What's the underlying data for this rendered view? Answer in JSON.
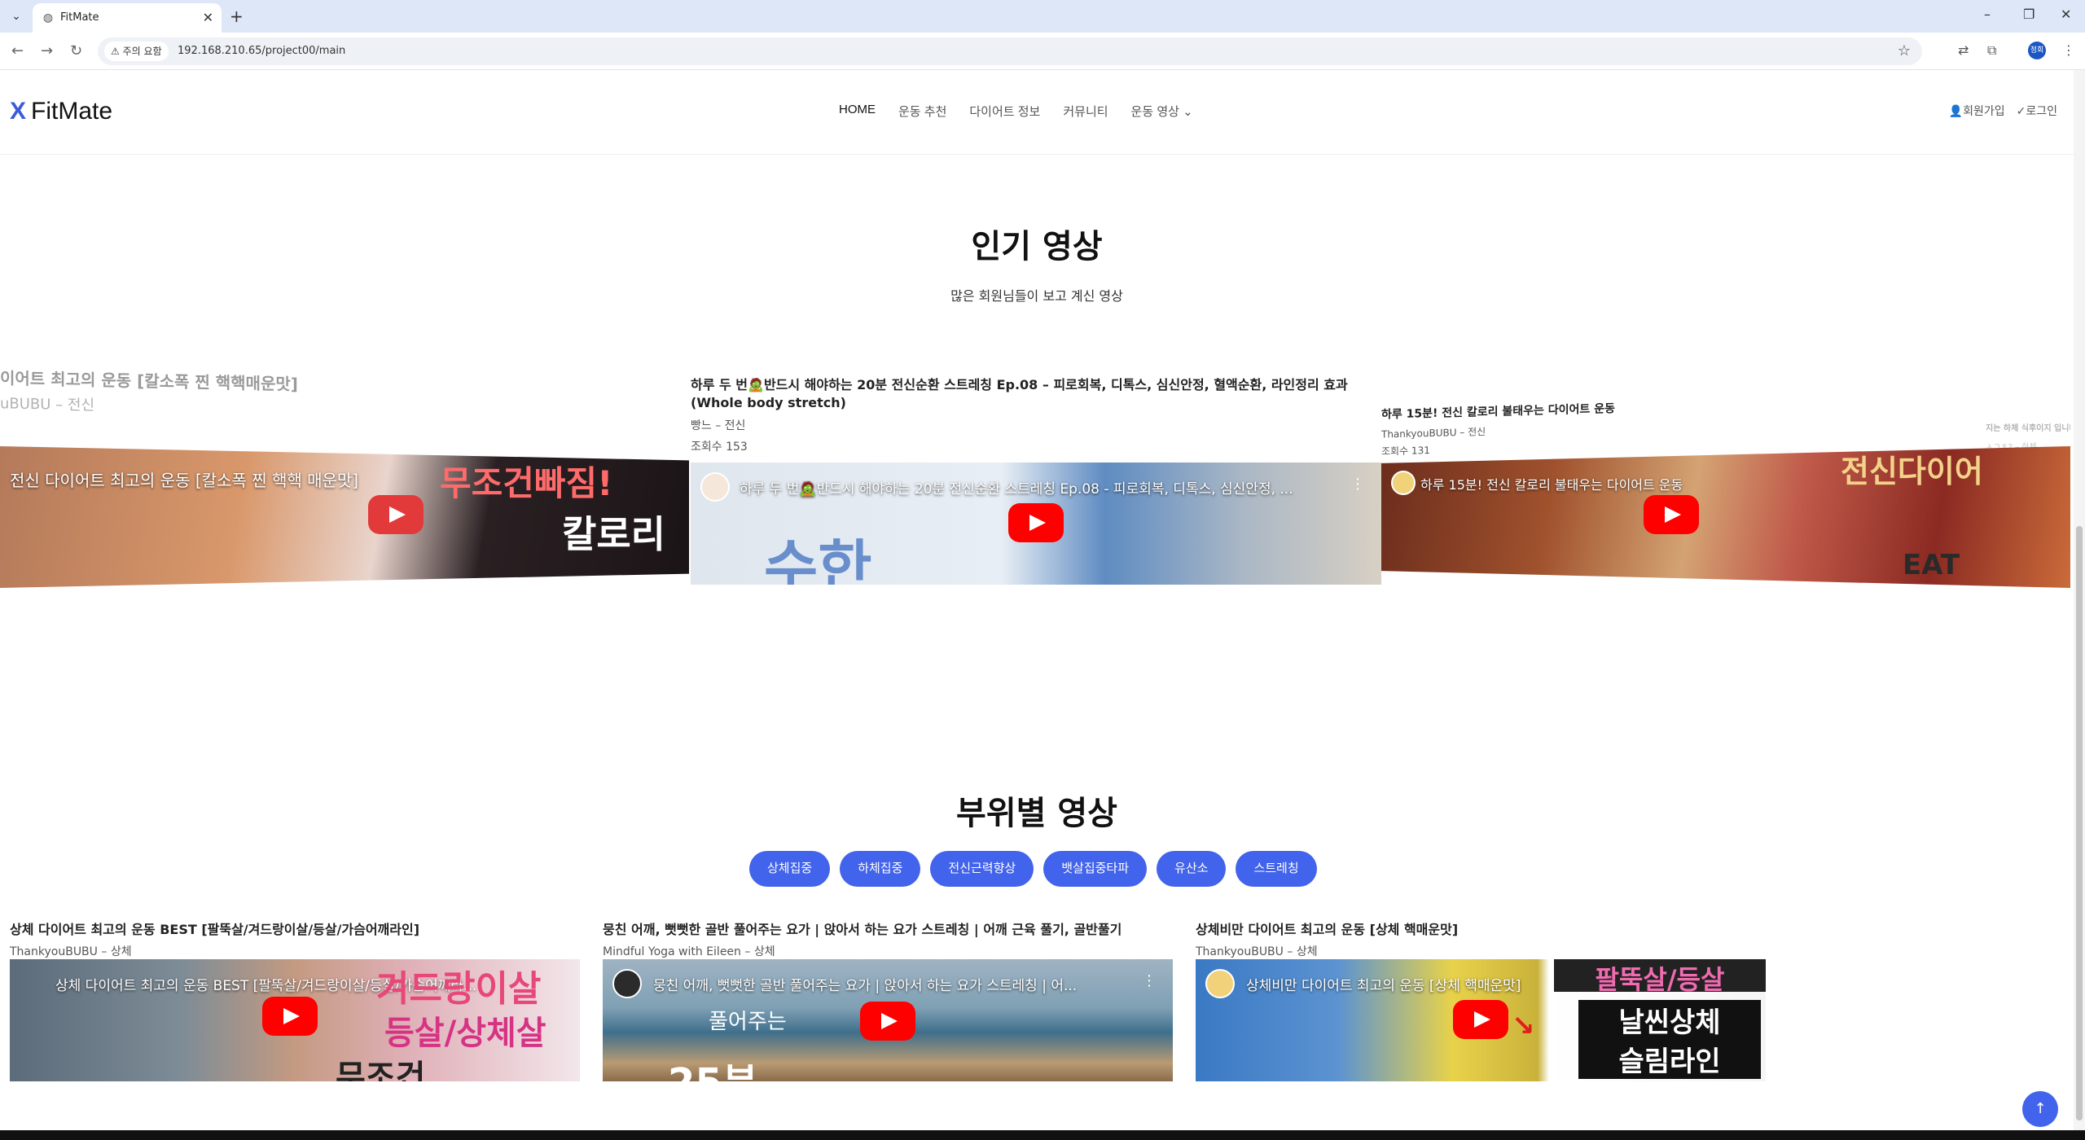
{
  "browser": {
    "tab_title": "FitMate",
    "security_label": "주의 요함",
    "url": "192.168.210.65/project00/main",
    "profile_initial": "정회"
  },
  "header": {
    "logo_mark": "X",
    "logo_text": "FitMate",
    "nav": [
      "HOME",
      "운동 추천",
      "다이어트 정보",
      "커뮤니티",
      "운동 영상"
    ],
    "signup": "회원가입",
    "login": "로그인"
  },
  "popular": {
    "title": "인기 영상",
    "subtitle": "많은 회원님들이 보고 계신 영상",
    "left_card": {
      "title": "이어트 최고의 운동 [칼소폭 찐 핵핵매운맛]",
      "meta": "uBUBU – 전신",
      "thumb_caption": "전신 다이어트 최고의 운동 [칼소폭 찐 핵핵 매운맛]",
      "overlay_1": "무조건빠짐!",
      "overlay_2": "칼로리"
    },
    "center_card": {
      "title": "하루 두 번🧟반드시 해야하는 20분 전신순환 스트레칭 Ep.08 – 피로회복, 디톡스, 심신안정, 혈액순환, 라인정리 효과 (Whole body stretch)",
      "meta": "빵느 – 전신",
      "views": "조회수 153",
      "thumb_caption": "하루 두 번🧟반드시 해야하는 20분 전신순환 스트레칭 Ep.08 - 피로회복, 디톡스, 심신안정, ..."
    },
    "right_card": {
      "title": "하루 15분! 전신 칼로리 불태우는 다이어트 운동",
      "meta": "ThankyouBUBU – 전신",
      "views": "조회수 131",
      "thumb_caption": "하루 15분! 전신 칼로리 불태우는 다이어트 운동",
      "overlay_1": "전신다이어",
      "overlay_2": "EAT"
    },
    "far_right_card": {
      "title": "지는 하체 식후이지 입니다",
      "meta": "ㅅㄱㅊ? – 하체"
    }
  },
  "body_parts": {
    "title": "부위별 영상",
    "filters": [
      "상체집중",
      "하체집중",
      "전신근력향상",
      "뱃살집중타파",
      "유산소",
      "스트레칭"
    ],
    "cards": [
      {
        "title": "상체 다이어트 최고의 운동 BEST [팔뚝살/겨드랑이살/등살/가슴어깨라인]",
        "meta": "ThankyouBUBU – 상체",
        "thumb_caption": "상체 다이어트 최고의 운동 BEST [팔뚝살/겨드랑이살/등살/가슴어깨라...",
        "overlay_1": "겨드랑이살",
        "overlay_2": "등살/상체살",
        "overlay_3": "무조건"
      },
      {
        "title": "뭉친 어깨, 뻣뻣한 골반 풀어주는 요가 | 앉아서 하는 요가 스트레칭 | 어깨 근육 풀기, 골반풀기",
        "meta": "Mindful Yoga with Eileen – 상체",
        "thumb_caption": "뭉친 어깨, 뻣뻣한 골반 풀어주는 요가 | 앉아서 하는 요가 스트레칭 | 어...",
        "overlay_1": "풀어주는",
        "overlay_2": "25분"
      },
      {
        "title": "상체비만 다이어트 최고의 운동 [상체 핵매운맛]",
        "meta": "ThankyouBUBU – 상체",
        "thumb_caption": "상체비만 다이어트 최고의 운동 [상체 핵매운맛]",
        "overlay_1": "팔뚝살/등살",
        "overlay_2": "날씬상체",
        "overlay_3": "슬림라인"
      }
    ]
  },
  "colors": {
    "accent": "#4263eb",
    "youtube_red": "#ff0000"
  }
}
